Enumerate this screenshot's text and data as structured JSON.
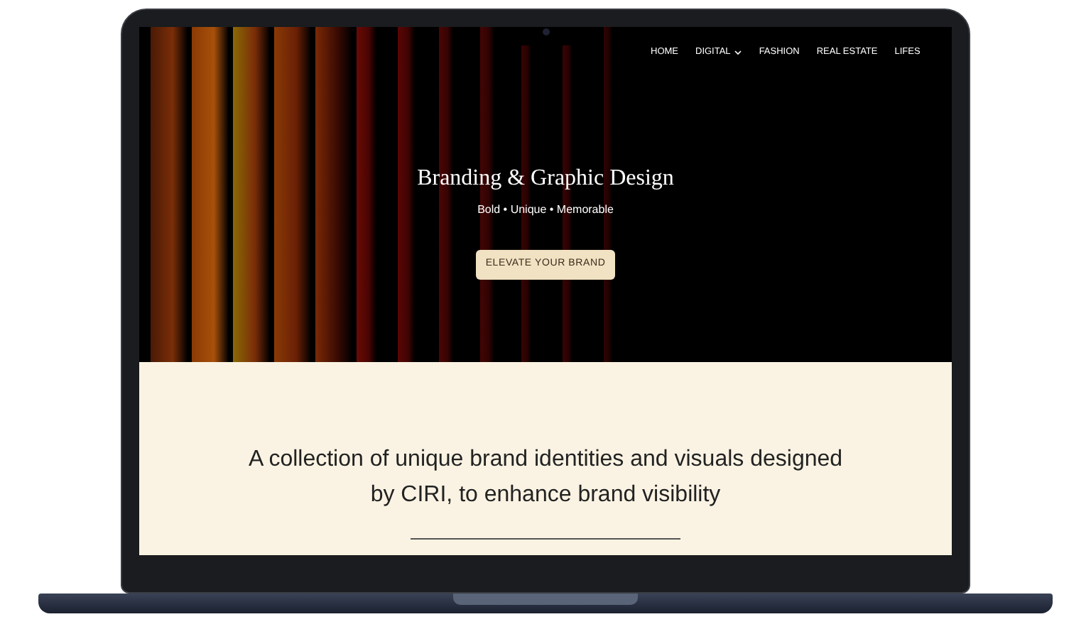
{
  "nav": {
    "items": [
      {
        "label": "HOME",
        "dropdown": false
      },
      {
        "label": "DIGITAL",
        "dropdown": true
      },
      {
        "label": "FASHION",
        "dropdown": false
      },
      {
        "label": "REAL ESTATE",
        "dropdown": false
      },
      {
        "label": "LIFES",
        "dropdown": false
      }
    ]
  },
  "hero": {
    "title": "Branding & Graphic Design",
    "tagline": "Bold • Unique • Memorable",
    "button": "ELEVATE YOUR BRAND"
  },
  "intro": {
    "text": "A collection of unique brand identities and visuals designed by CIRI, to enhance brand visibility"
  }
}
